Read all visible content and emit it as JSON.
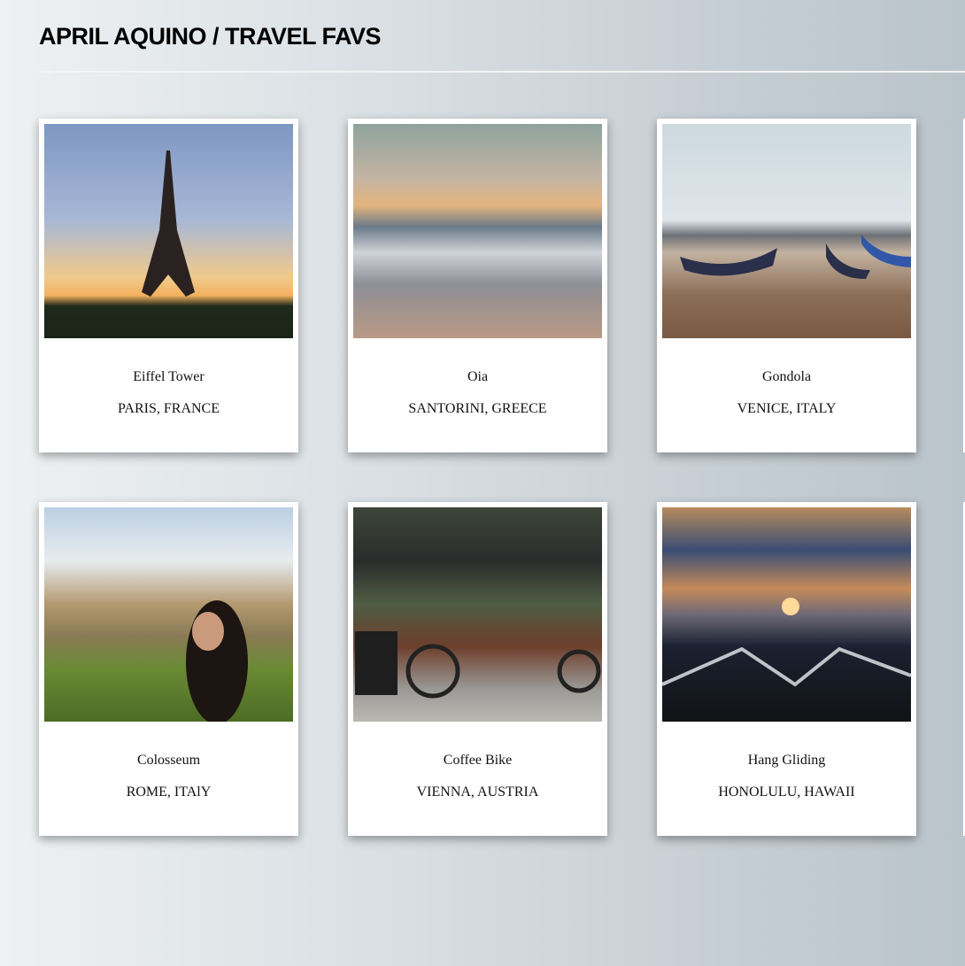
{
  "header": {
    "title": "APRIL AQUINO / TRAVEL FAVS"
  },
  "cards": [
    {
      "title": "Eiffel Tower",
      "location": "PARIS, FRANCE",
      "image": "eiffel-tower-photo"
    },
    {
      "title": "Oia",
      "location": "SANTORINI, GREECE",
      "image": "oia-photo"
    },
    {
      "title": "Gondola",
      "location": "VENICE, ITALY",
      "image": "gondola-photo"
    },
    {
      "title": "Colosseum",
      "location": "ROME, ITAlY",
      "image": "colosseum-photo"
    },
    {
      "title": "Coffee Bike",
      "location": "VIENNA, AUSTRIA",
      "image": "coffee-bike-photo"
    },
    {
      "title": "Hang Gliding",
      "location": "HONOLULU, HAWAII",
      "image": "hang-gliding-photo"
    }
  ]
}
